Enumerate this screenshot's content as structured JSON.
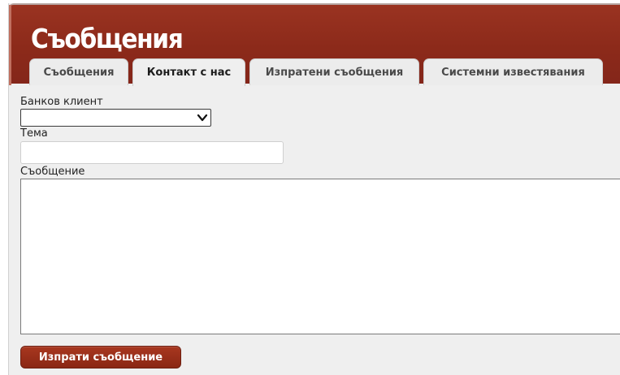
{
  "header": {
    "title": "Съобщения"
  },
  "tabs": [
    {
      "label": "Съобщения",
      "active": false
    },
    {
      "label": "Контакт с нас",
      "active": true
    },
    {
      "label": "Изпратени съобщения",
      "active": false
    },
    {
      "label": "Системни известявания",
      "active": false
    }
  ],
  "form": {
    "bank_client_label": "Банков клиент",
    "bank_client_value": "",
    "subject_label": "Тема",
    "subject_value": "",
    "message_label": "Съобщение",
    "message_value": "",
    "send_label": "Изпрати съобщение"
  },
  "colors": {
    "header": "#8c2a1a",
    "button": "#9a3019",
    "panel": "#efefef"
  }
}
